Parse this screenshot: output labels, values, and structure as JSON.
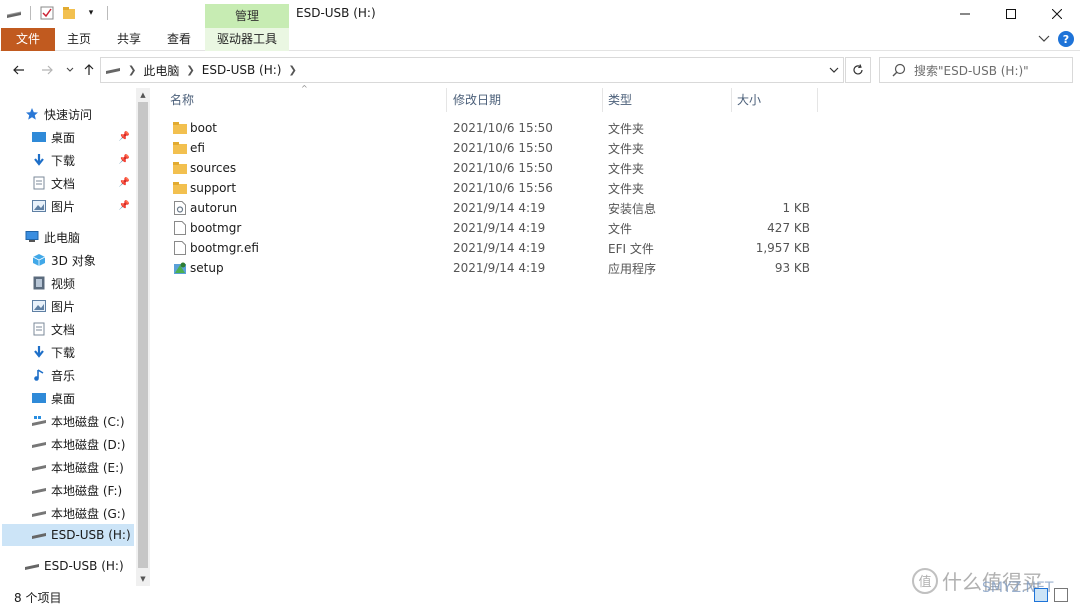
{
  "title": {
    "manage_tab": "管理",
    "window_title": "ESD-USB (H:)"
  },
  "ribbon": {
    "tabs": [
      "文件",
      "主页",
      "共享",
      "查看",
      "驱动器工具"
    ]
  },
  "address": {
    "crumbs": [
      "此电脑",
      "ESD-USB (H:)"
    ],
    "search_placeholder": "搜索\"ESD-USB (H:)\""
  },
  "nav": {
    "quick_access": "快速访问",
    "quick_items": [
      "桌面",
      "下载",
      "文档",
      "图片"
    ],
    "this_pc": "此电脑",
    "pc_items": [
      "3D 对象",
      "视频",
      "图片",
      "文档",
      "下载",
      "音乐",
      "桌面",
      "本地磁盘 (C:)",
      "本地磁盘 (D:)",
      "本地磁盘 (E:)",
      "本地磁盘 (F:)",
      "本地磁盘 (G:)",
      "ESD-USB (H:)"
    ],
    "usb_root": "ESD-USB (H:)"
  },
  "columns": [
    "名称",
    "修改日期",
    "类型",
    "大小"
  ],
  "files": [
    {
      "name": "boot",
      "date": "2021/10/6 15:50",
      "type": "文件夹",
      "size": "",
      "icon": "folder-icon"
    },
    {
      "name": "efi",
      "date": "2021/10/6 15:50",
      "type": "文件夹",
      "size": "",
      "icon": "folder-icon"
    },
    {
      "name": "sources",
      "date": "2021/10/6 15:50",
      "type": "文件夹",
      "size": "",
      "icon": "folder-icon"
    },
    {
      "name": "support",
      "date": "2021/10/6 15:56",
      "type": "文件夹",
      "size": "",
      "icon": "folder-icon"
    },
    {
      "name": "autorun",
      "date": "2021/9/14 4:19",
      "type": "安装信息",
      "size": "1 KB",
      "icon": "settings-file-icon"
    },
    {
      "name": "bootmgr",
      "date": "2021/9/14 4:19",
      "type": "文件",
      "size": "427 KB",
      "icon": "file-icon"
    },
    {
      "name": "bootmgr.efi",
      "date": "2021/9/14 4:19",
      "type": "EFI 文件",
      "size": "1,957 KB",
      "icon": "file-icon"
    },
    {
      "name": "setup",
      "date": "2021/9/14 4:19",
      "type": "应用程序",
      "size": "93 KB",
      "icon": "setup-app-icon"
    }
  ],
  "status": {
    "item_count": "8 个项目"
  },
  "watermark": {
    "text": "什么值得买",
    "overlay": "SMYZ.NET"
  },
  "colors": {
    "file_tab": "#c15a1f",
    "manage_tab": "#c7ecb3",
    "selected_nav": "#cce4f7",
    "folder": "#f2c04f"
  }
}
